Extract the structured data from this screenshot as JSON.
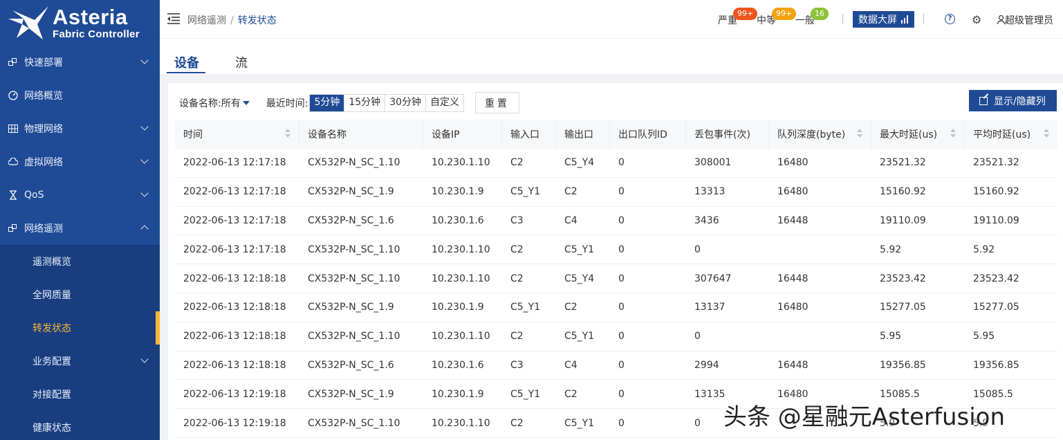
{
  "logo": {
    "title": "Asteria",
    "subtitle": "Fabric Controller"
  },
  "sidebar": {
    "items": [
      {
        "label": "快速部署",
        "icon": "deploy-icon",
        "expandable": true
      },
      {
        "label": "网络概览",
        "icon": "dashboard-icon",
        "expandable": false
      },
      {
        "label": "物理网络",
        "icon": "grid-icon",
        "expandable": true
      },
      {
        "label": "虚拟网络",
        "icon": "cloud-icon",
        "expandable": true
      },
      {
        "label": "QoS",
        "icon": "hourglass-icon",
        "expandable": true
      },
      {
        "label": "网络遥测",
        "icon": "telemetry-icon",
        "expandable": true,
        "expanded": true
      }
    ],
    "submenu": [
      {
        "label": "遥测概览"
      },
      {
        "label": "全网质量"
      },
      {
        "label": "转发状态",
        "active": true
      },
      {
        "label": "业务配置",
        "expandable": true
      },
      {
        "label": "对接配置"
      },
      {
        "label": "健康状态"
      }
    ]
  },
  "header": {
    "breadcrumb": {
      "parent": "网络遥测",
      "separator": "/",
      "current": "转发状态"
    },
    "alarms": [
      {
        "label": "严重",
        "count": "99+",
        "color": "#f0551e"
      },
      {
        "label": "中等",
        "count": "99+",
        "color": "#f5a30a"
      },
      {
        "label": "一般",
        "count": "16",
        "color": "#8cc43c"
      }
    ],
    "bigscreen_label": "数据大屏",
    "user_label": "超级管理员"
  },
  "tabs": [
    {
      "label": "设备",
      "active": true
    },
    {
      "label": "流",
      "active": false
    }
  ],
  "filters": {
    "device_label": "设备名称:所有",
    "recent_label": "最近时间:",
    "ranges": [
      {
        "label": "5分钟",
        "active": true
      },
      {
        "label": "15分钟",
        "active": false
      },
      {
        "label": "30分钟",
        "active": false
      },
      {
        "label": "自定义",
        "active": false
      }
    ],
    "reset_label": "重置",
    "toggle_columns_label": "显示/隐藏列"
  },
  "table": {
    "columns": [
      {
        "label": "时间",
        "sortable": true
      },
      {
        "label": "设备名称",
        "sortable": false
      },
      {
        "label": "设备IP",
        "sortable": false
      },
      {
        "label": "输入口",
        "sortable": false
      },
      {
        "label": "输出口",
        "sortable": false
      },
      {
        "label": "出口队列ID",
        "sortable": false
      },
      {
        "label": "丢包事件(次)",
        "sortable": false
      },
      {
        "label": "队列深度(byte)",
        "sortable": true
      },
      {
        "label": "最大时延(us)",
        "sortable": true
      },
      {
        "label": "平均时延(us)",
        "sortable": true
      }
    ],
    "rows": [
      [
        "2022-06-13 12:17:18",
        "CX532P-N_SC_1.10",
        "10.230.1.10",
        "C2",
        "C5_Y4",
        "0",
        "308001",
        "16480",
        "23521.32",
        "23521.32"
      ],
      [
        "2022-06-13 12:17:18",
        "CX532P-N_SC_1.9",
        "10.230.1.9",
        "C5_Y1",
        "C2",
        "0",
        "13313",
        "16480",
        "15160.92",
        "15160.92"
      ],
      [
        "2022-06-13 12:17:18",
        "CX532P-N_SC_1.6",
        "10.230.1.6",
        "C3",
        "C4",
        "0",
        "3436",
        "16448",
        "19110.09",
        "19110.09"
      ],
      [
        "2022-06-13 12:17:18",
        "CX532P-N_SC_1.10",
        "10.230.1.10",
        "C2",
        "C5_Y1",
        "0",
        "0",
        "",
        "5.92",
        "5.92"
      ],
      [
        "2022-06-13 12:18:18",
        "CX532P-N_SC_1.10",
        "10.230.1.10",
        "C2",
        "C5_Y4",
        "0",
        "307647",
        "16448",
        "23523.42",
        "23523.42"
      ],
      [
        "2022-06-13 12:18:18",
        "CX532P-N_SC_1.9",
        "10.230.1.9",
        "C5_Y1",
        "C2",
        "0",
        "13137",
        "16480",
        "15277.05",
        "15277.05"
      ],
      [
        "2022-06-13 12:18:18",
        "CX532P-N_SC_1.10",
        "10.230.1.10",
        "C2",
        "C5_Y1",
        "0",
        "0",
        "",
        "5.95",
        "5.95"
      ],
      [
        "2022-06-13 12:18:18",
        "CX532P-N_SC_1.6",
        "10.230.1.6",
        "C3",
        "C4",
        "0",
        "2994",
        "16448",
        "19356.85",
        "19356.85"
      ],
      [
        "2022-06-13 12:19:18",
        "CX532P-N_SC_1.9",
        "10.230.1.9",
        "C5_Y1",
        "C2",
        "0",
        "13135",
        "16480",
        "15085.5",
        "15085.5"
      ],
      [
        "2022-06-13 12:19:18",
        "CX532P-N_SC_1.10",
        "10.230.1.10",
        "C2",
        "C5_Y1",
        "0",
        "0",
        "",
        "5.9",
        "5.9"
      ]
    ]
  },
  "watermark": "头条 @星融元Asterfusion"
}
